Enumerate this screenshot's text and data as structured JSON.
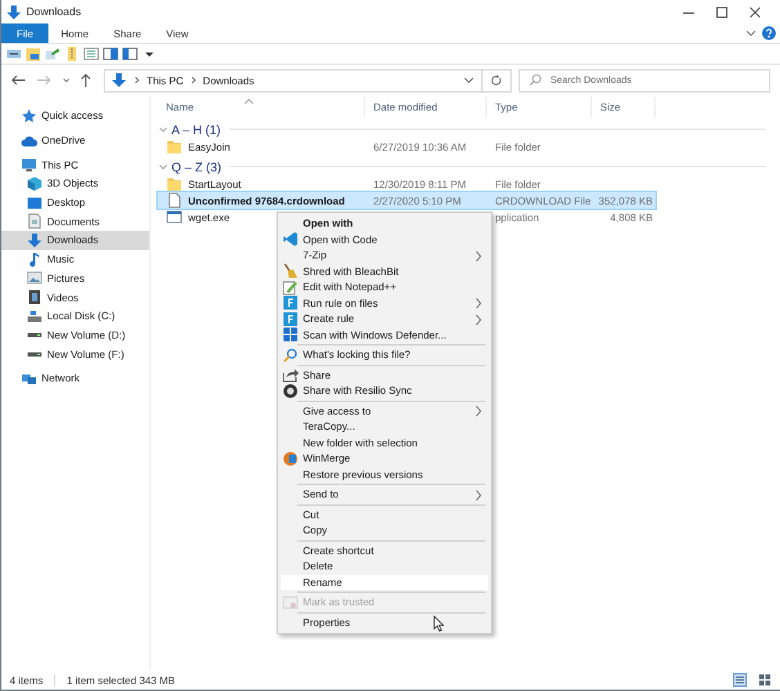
{
  "window": {
    "title": "Downloads"
  },
  "ribbon_tabs": [
    {
      "label": "File",
      "selected": true
    },
    {
      "label": "Home",
      "selected": false
    },
    {
      "label": "Share",
      "selected": false
    },
    {
      "label": "View",
      "selected": false
    }
  ],
  "address": {
    "path": [
      "This PC",
      "Downloads"
    ]
  },
  "search": {
    "placeholder": "Search Downloads"
  },
  "sidebar": {
    "items": [
      {
        "label": "Quick access",
        "selected": false
      },
      {
        "label": "OneDrive",
        "selected": false
      },
      {
        "label": "This PC",
        "selected": false,
        "children": [
          {
            "label": "3D Objects",
            "selected": false
          },
          {
            "label": "Desktop",
            "selected": false
          },
          {
            "label": "Documents",
            "selected": false
          },
          {
            "label": "Downloads",
            "selected": true
          },
          {
            "label": "Music",
            "selected": false
          },
          {
            "label": "Pictures",
            "selected": false
          },
          {
            "label": "Videos",
            "selected": false
          },
          {
            "label": "Local Disk (C:)",
            "selected": false
          },
          {
            "label": "New Volume (D:)",
            "selected": false
          },
          {
            "label": "New Volume (F:)",
            "selected": false
          }
        ]
      },
      {
        "label": "Network",
        "selected": false
      }
    ]
  },
  "table": {
    "columns": [
      "Name",
      "Date modified",
      "Type",
      "Size"
    ],
    "groups": [
      {
        "label": "A – H (1)",
        "rows": [
          {
            "name": "EasyJoin",
            "date": "6/27/2019 10:36 AM",
            "type": "File folder",
            "kind": "folder",
            "selected": false
          }
        ]
      },
      {
        "label": "Q – Z (3)",
        "rows": [
          {
            "name": "StartLayout",
            "date": "12/30/2019 8:11 PM",
            "type": "File folder",
            "kind": "folder",
            "selected": false
          },
          {
            "name": "Unconfirmed 97684.crdownload",
            "date": "2/27/2020 5:10 PM",
            "type": "CRDOWNLOAD File",
            "size": "352,078 KB",
            "kind": "file",
            "selected": true
          },
          {
            "name": "wget.exe",
            "type": "pplication",
            "size": "4,808 KB",
            "kind": "exe",
            "selected": false
          }
        ]
      }
    ]
  },
  "context_menu": {
    "groups": [
      [
        {
          "label": "Open with",
          "bold": true
        },
        {
          "label": "Open with Code"
        },
        {
          "label": "7-Zip",
          "submenu": true
        },
        {
          "label": "Shred with BleachBit"
        },
        {
          "label": "Edit with Notepad++"
        },
        {
          "label": "Run rule on files",
          "submenu": true
        },
        {
          "label": "Create rule",
          "submenu": true
        },
        {
          "label": "Scan with Windows Defender..."
        }
      ],
      [
        {
          "label": "What's locking this file?"
        }
      ],
      [
        {
          "label": "Share"
        },
        {
          "label": "Share with Resilio Sync"
        }
      ],
      [
        {
          "label": "Give access to",
          "submenu": true
        },
        {
          "label": "TeraCopy..."
        },
        {
          "label": "New folder with selection"
        },
        {
          "label": "WinMerge"
        },
        {
          "label": "Restore previous versions"
        }
      ],
      [
        {
          "label": "Send to",
          "submenu": true
        }
      ],
      [
        {
          "label": "Cut"
        },
        {
          "label": "Copy"
        }
      ],
      [
        {
          "label": "Create shortcut"
        },
        {
          "label": "Delete"
        },
        {
          "label": "Rename",
          "hovered": true
        }
      ],
      [
        {
          "label": "Mark as trusted",
          "disabled": true
        }
      ],
      [
        {
          "label": "Properties"
        }
      ]
    ]
  },
  "status_bar": {
    "items": [
      "4 items",
      "1 item selected  343 MB"
    ]
  }
}
